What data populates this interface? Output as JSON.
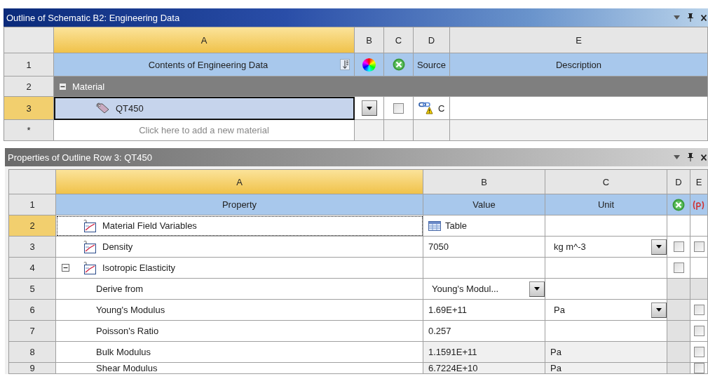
{
  "outline": {
    "title": "Outline of Schematic B2: Engineering Data",
    "columns": [
      {
        "label": "A",
        "selected": true
      },
      {
        "label": "B",
        "selected": false
      },
      {
        "label": "C",
        "selected": false
      },
      {
        "label": "D",
        "selected": false
      },
      {
        "label": "E",
        "selected": false
      }
    ],
    "header": {
      "number": "1",
      "contents": "Contents of Engineering Data",
      "source": "Source",
      "description": "Description"
    },
    "rows": [
      {
        "kind": "group",
        "number": "2",
        "label": "Material",
        "expanded": true,
        "selected": false
      },
      {
        "kind": "material",
        "number": "3",
        "label": "QT450",
        "selected": true,
        "checked": false,
        "source": "C"
      },
      {
        "kind": "add",
        "number": "*",
        "label": "Click here to add a new material",
        "selected": false
      }
    ]
  },
  "properties": {
    "title": "Properties of Outline Row 3: QT450",
    "columns": [
      {
        "label": "A",
        "selected": true
      },
      {
        "label": "B",
        "selected": false
      },
      {
        "label": "C",
        "selected": false
      },
      {
        "label": "D",
        "selected": false
      },
      {
        "label": "E",
        "selected": false
      }
    ],
    "header": {
      "number": "1",
      "property": "Property",
      "value": "Value",
      "unit": "Unit"
    },
    "rows": [
      {
        "kind": "property",
        "number": "2",
        "label": "Material Field Variables",
        "selected": true,
        "value": {
          "kind": "table",
          "text": "Table"
        },
        "locked": false
      },
      {
        "kind": "property",
        "number": "3",
        "label": "Density",
        "selected": false,
        "value": {
          "kind": "text",
          "text": "7050"
        },
        "unit": "kg m^-3",
        "unit_dropdown": true,
        "d": {
          "checked": false
        },
        "e": {
          "checked": false
        },
        "locked": false
      },
      {
        "kind": "property",
        "number": "4",
        "label": "Isotropic Elasticity",
        "selected": false,
        "expanded": true,
        "d": {
          "checked": false
        },
        "locked": false
      },
      {
        "kind": "sub",
        "number": "5",
        "label": "Derive from",
        "selected": false,
        "value": {
          "kind": "dropdown",
          "text": "Young's Modul..."
        },
        "locked": true
      },
      {
        "kind": "sub",
        "number": "6",
        "label": "Young's Modulus",
        "selected": false,
        "value": {
          "kind": "text",
          "text": "1.69E+11"
        },
        "unit": "Pa",
        "unit_dropdown": true,
        "e": {
          "checked": false
        },
        "locked": true
      },
      {
        "kind": "sub",
        "number": "7",
        "label": "Poisson's Ratio",
        "selected": false,
        "value": {
          "kind": "text",
          "text": "0.257"
        },
        "e": {
          "checked": false
        },
        "locked": true
      },
      {
        "kind": "sub",
        "number": "8",
        "label": "Bulk Modulus",
        "selected": false,
        "value": {
          "kind": "readonly",
          "text": "1.1591E+11"
        },
        "unit": "Pa",
        "unit_dropdown": false,
        "e": {
          "checked": false
        },
        "locked": true
      },
      {
        "kind": "sub",
        "number": "9",
        "label": "Shear Modulus",
        "selected": false,
        "value": {
          "kind": "readonly",
          "text": "6.7224E+10"
        },
        "unit": "Pa",
        "unit_dropdown": false,
        "e": {
          "checked": false
        },
        "locked": true
      }
    ]
  }
}
